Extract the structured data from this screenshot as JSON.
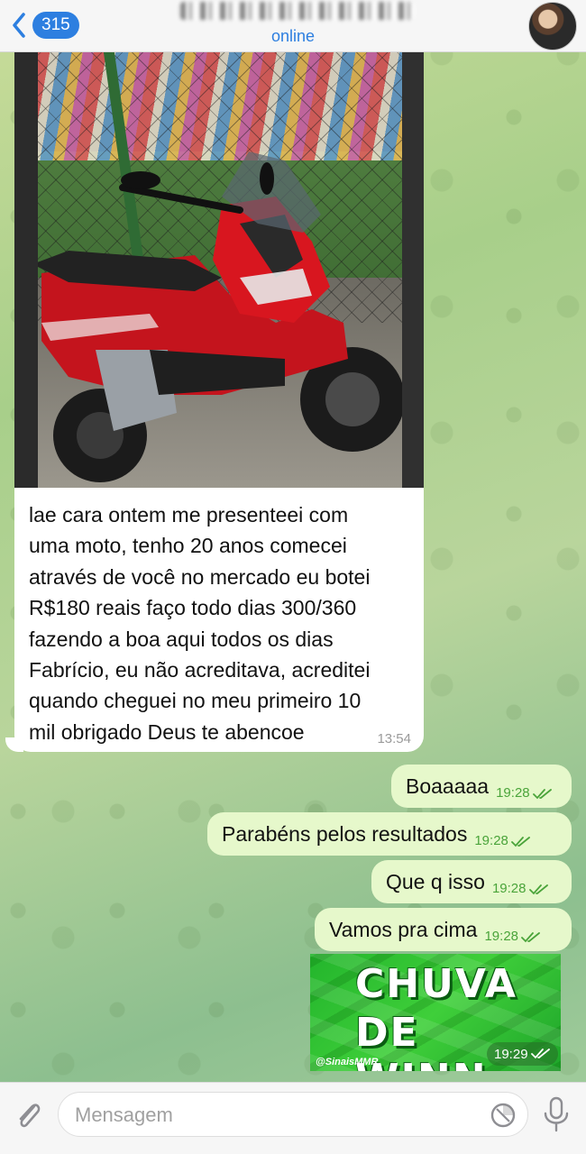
{
  "header": {
    "back_count": "315",
    "contact_name": "",
    "status": "online"
  },
  "incoming": {
    "text_lines": [
      "lae cara ontem me presenteei com",
      "uma moto, tenho 20 anos comecei",
      "através de você no mercado eu botei",
      "R$180 reais faço todo dias 300/360",
      "fazendo a boa aqui todos os dias",
      "Fabrício, eu não acreditava, acreditei",
      "quando cheguei no meu primeiro 10",
      "mil obrigado Deus te abencoe"
    ],
    "time": "13:54"
  },
  "outgoing": [
    {
      "text": "Boaaaaa",
      "time": "19:28"
    },
    {
      "text": "Parabéns pelos resultados",
      "time": "19:28"
    },
    {
      "text": "Que q isso",
      "time": "19:28"
    },
    {
      "text": "Vamos pra cima",
      "time": "19:28"
    }
  ],
  "sticker": {
    "line1": "CHUVA",
    "line2": "DE WINN",
    "handle": "@SinaisMMR",
    "time": "19:29"
  },
  "input": {
    "placeholder": "Mensagem"
  },
  "colors": {
    "accent": "#2d7fe0",
    "outgoing_bubble": "#e6f8cb",
    "check": "#4aa43a"
  }
}
